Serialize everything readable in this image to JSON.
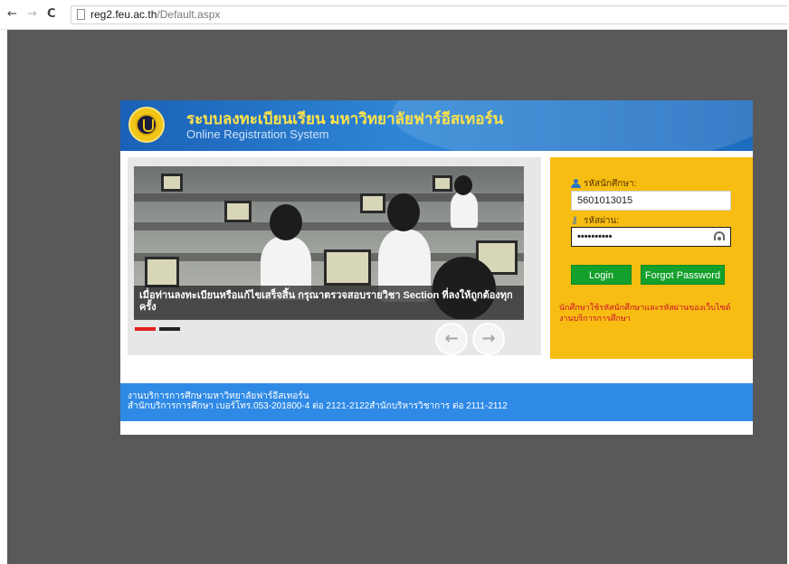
{
  "browser": {
    "nav_back": "←",
    "nav_forward": "→",
    "nav_reload": "C",
    "url_host": "reg2.feu.ac.th",
    "url_path": "/Default.aspx"
  },
  "header": {
    "title_thai": "ระบบลงทะเบียนเรียน มหาวิทยาลัยฟาร์อีสเทอร์น",
    "title_english": "Online Registration System"
  },
  "slider": {
    "caption": "เมื่อท่านลงทะเบียนหรือแก้ไขเสร็จสิ้น กรุณาตรวจสอบรายวิชา Section ที่ลงให้ถูกต้องทุกครั้ง",
    "prev_symbol": "←",
    "next_symbol": "→"
  },
  "login": {
    "student_id_label": "รหัสนักศึกษา:",
    "student_id_value": "5601013015",
    "password_label": "รหัสผ่าน:",
    "password_value": "••••••••••",
    "login_button": "Login",
    "forgot_button": "Forgot Password",
    "note": "นักศึกษาใช้รหัสนักศึกษาและรหัสผ่านของเว็บไซต์งานบริการการศึกษา"
  },
  "footer": {
    "line1": "งานบริการการศึกษามหาวิทยาลัยฟาร์อีสเทอร์น",
    "line2": "สำนักบริการการศึกษา เบอร์โทร.053-201800-4 ต่อ 2121-2122สำนักบริหารวิชาการ ต่อ 2111-2112"
  },
  "colors": {
    "page_background": "#595959",
    "header_blue": "#2f86d6",
    "login_panel": "#f8bd12",
    "button_green": "#14a02c",
    "footer_blue": "#2f8ae6",
    "note_red": "#c8102e"
  }
}
